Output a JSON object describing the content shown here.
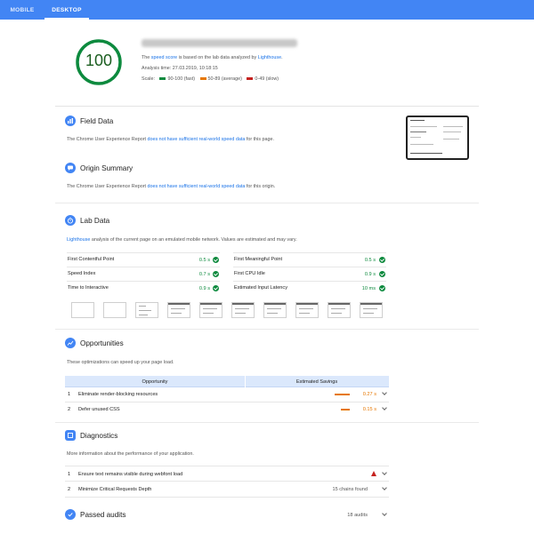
{
  "tabs": [
    {
      "label": "MOBILE",
      "active": false
    },
    {
      "label": "DESKTOP",
      "active": true
    }
  ],
  "score": {
    "value": "100",
    "url": "http://londonscaps.co.uk/contentspeedtest.ru.uk",
    "line1_pre": "The ",
    "line1_link": "speed score",
    "line1_mid": " is based on the lab data analyzed by ",
    "line1_link2": "Lighthouse",
    "line1_post": ".",
    "analysis_time": "Analysis time: 27.03.2019, 10:18:15",
    "legend_label": "Scale:",
    "legend": [
      {
        "text": "90-100 (fast)",
        "color": "#0d8a3e"
      },
      {
        "text": "50-89 (average)",
        "color": "#e67700"
      },
      {
        "text": "0-49 (slow)",
        "color": "#c5221f"
      }
    ]
  },
  "field_data": {
    "title": "Field Data",
    "text_pre": "The Chrome User Experience Report ",
    "text_link": "does not have sufficient real-world speed data",
    "text_post": " for this page."
  },
  "origin_summary": {
    "title": "Origin Summary",
    "text_pre": "The Chrome User Experience Report ",
    "text_link": "does not have sufficient real-world speed data",
    "text_post": " for this origin."
  },
  "lab_data": {
    "title": "Lab Data",
    "text_link": "Lighthouse",
    "text_post": " analysis of the current page on an emulated mobile network. Values are estimated and may vary.",
    "metrics": [
      {
        "label": "First Contentful Point",
        "value": "0.5 s"
      },
      {
        "label": "First Meaningful Point",
        "value": "0.5 s"
      },
      {
        "label": "Speed Index",
        "value": "0.7 s"
      },
      {
        "label": "First CPU Idle",
        "value": "0.9 s"
      },
      {
        "label": "Time to Interactive",
        "value": "0.9 s"
      },
      {
        "label": "Estimated Input Latency",
        "value": "10 ms"
      }
    ]
  },
  "opportunities": {
    "title": "Opportunities",
    "text": "These optimizations can speed up your page load.",
    "col_opportunity": "Opportunity",
    "col_savings": "Estimated Savings",
    "rows": [
      {
        "num": "1",
        "label": "Eliminate render-blocking resources",
        "savings": "0.27 s",
        "bar_fraction": 0.45
      },
      {
        "num": "2",
        "label": "Defer unused CSS",
        "savings": "0.15 s",
        "bar_fraction": 0.25
      }
    ]
  },
  "diagnostics": {
    "title": "Diagnostics",
    "text": "More information about the performance of your application.",
    "rows": [
      {
        "num": "1",
        "label": "Ensure text remains visible during webfont load",
        "extra": ""
      },
      {
        "num": "2",
        "label": "Minimize Critical Requests Depth",
        "extra": "15 chains found"
      }
    ]
  },
  "passed": {
    "title": "Passed audits",
    "count": "18 audits"
  },
  "colors": {
    "accent": "#4285f4",
    "fast": "#0d8a3e",
    "average": "#e67700",
    "slow": "#c5221f"
  }
}
